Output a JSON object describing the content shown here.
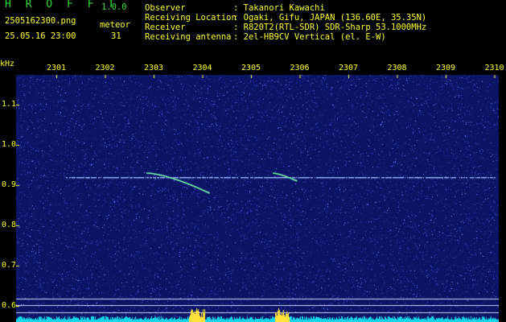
{
  "header": {
    "app_name": "H R O F F T",
    "version": "1.0.0",
    "file_name": "2505162300.png",
    "mode": "meteor",
    "timestamp": "25.05.16 23:00",
    "count": "31",
    "info": [
      {
        "label": "Observer",
        "value": ": Takanori Kawachi"
      },
      {
        "label": "Receiving Location",
        "value": ": Ogaki, Gifu, JAPAN (136.60E, 35.35N)"
      },
      {
        "label": "Receiver",
        "value": ": R820T2(RTL-SDR) SDR-Sharp 53.1000MHz"
      },
      {
        "label": "Receiving antenna",
        "value": ": 2el-HB9CV Vertical (el. E-W)"
      }
    ]
  },
  "chart_data": {
    "type": "heatmap",
    "ylabel": "kHz",
    "x_ticks": [
      "2301",
      "2302",
      "2303",
      "2304",
      "2305",
      "2306",
      "2307",
      "2308",
      "2309",
      "2310"
    ],
    "y_ticks": [
      "1.1",
      "1.0",
      "0.9",
      "0.8",
      "0.7",
      "0.6"
    ],
    "carrier_khz": 0.92,
    "meteor_echoes": [
      {
        "start_time": "2302.85",
        "end_time": "2304.15",
        "start_khz": 0.93,
        "end_khz": 0.88
      },
      {
        "start_time": "2305.45",
        "end_time": "2305.95",
        "start_khz": 0.93,
        "end_khz": 0.91
      }
    ],
    "colors": {
      "background": "#0c1466",
      "noise": "#3a52c8",
      "echo": "#7fffb0",
      "labels": "#ffff33"
    }
  }
}
